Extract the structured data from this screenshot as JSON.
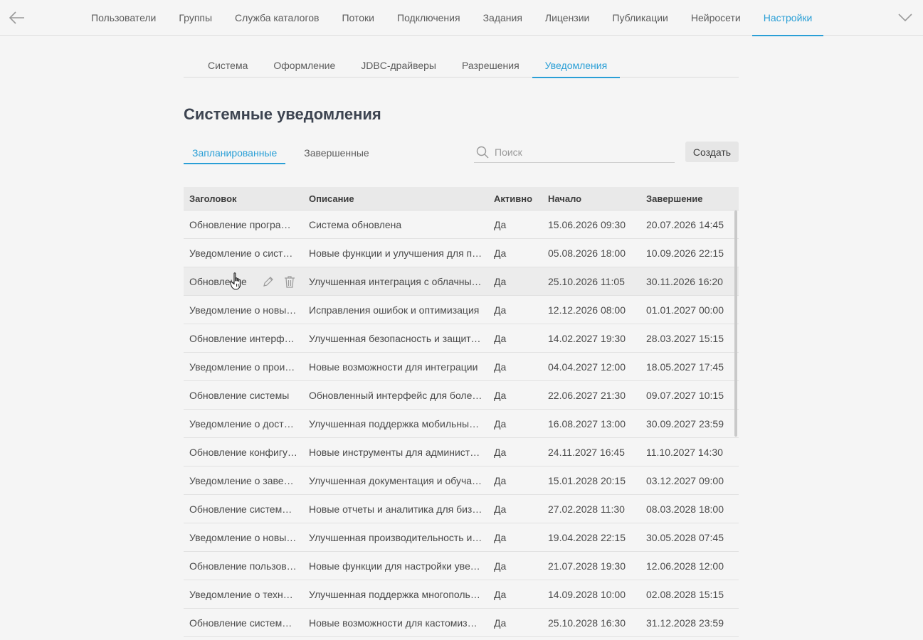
{
  "nav": {
    "items": [
      {
        "label": "Пользователи",
        "active": false
      },
      {
        "label": "Группы",
        "active": false
      },
      {
        "label": "Служба каталогов",
        "active": false
      },
      {
        "label": "Потоки",
        "active": false
      },
      {
        "label": "Подключения",
        "active": false
      },
      {
        "label": "Задания",
        "active": false
      },
      {
        "label": "Лицензии",
        "active": false
      },
      {
        "label": "Публикации",
        "active": false
      },
      {
        "label": "Нейросети",
        "active": false
      },
      {
        "label": "Настройки",
        "active": true
      }
    ]
  },
  "settings_tabs": [
    {
      "label": "Система",
      "active": false
    },
    {
      "label": "Оформление",
      "active": false
    },
    {
      "label": "JDBC-драйверы",
      "active": false
    },
    {
      "label": "Разрешения",
      "active": false
    },
    {
      "label": "Уведомления",
      "active": true
    }
  ],
  "page": {
    "title": "Системные уведомления"
  },
  "filter_tabs": [
    {
      "label": "Запланированные",
      "active": true
    },
    {
      "label": "Завершенные",
      "active": false
    }
  ],
  "search": {
    "placeholder": "Поиск",
    "value": ""
  },
  "create_label": "Создать",
  "table": {
    "columns": [
      "Заголовок",
      "Описание",
      "Активно",
      "Начало",
      "Завершение"
    ],
    "rows": [
      {
        "title": "Обновление программного обеспечения",
        "desc": "Система обновлена",
        "active": "Да",
        "start": "15.06.2026 09:30",
        "end": "20.07.2026 14:45"
      },
      {
        "title": "Уведомление о системе",
        "desc": "Новые функции и улучшения для пользователей",
        "active": "Да",
        "start": "05.08.2026 18:00",
        "end": "10.09.2026 22:15"
      },
      {
        "title": "Обновление",
        "desc": "Улучшенная интеграция с облачными сервисами",
        "active": "Да",
        "start": "25.10.2026 11:05",
        "end": "30.11.2026 16:20",
        "hover": true
      },
      {
        "title": "Уведомление о новых функциях",
        "desc": "Исправления ошибок и оптимизация",
        "active": "Да",
        "start": "12.12.2026 08:00",
        "end": "01.01.2027 00:00"
      },
      {
        "title": "Обновление интерфейса",
        "desc": "Улучшенная безопасность и защита данных",
        "active": "Да",
        "start": "14.02.2027 19:30",
        "end": "28.03.2027 15:15"
      },
      {
        "title": "Уведомление о производительности",
        "desc": "Новые возможности для интеграции",
        "active": "Да",
        "start": "04.04.2027 12:00",
        "end": "18.05.2027 17:45"
      },
      {
        "title": "Обновление системы",
        "desc": "Обновленный интерфейс для более удобной работы",
        "active": "Да",
        "start": "22.06.2027 21:30",
        "end": "09.07.2027 10:15"
      },
      {
        "title": "Уведомление о доступности",
        "desc": "Улучшенная поддержка мобильных устройств",
        "active": "Да",
        "start": "16.08.2027 13:00",
        "end": "30.09.2027 23:59"
      },
      {
        "title": "Обновление конфигурации",
        "desc": "Новые инструменты для администраторов",
        "active": "Да",
        "start": "24.11.2027 16:45",
        "end": "11.10.2027 14:30"
      },
      {
        "title": "Уведомление о завершении",
        "desc": "Улучшенная документация и обучающие материалы",
        "active": "Да",
        "start": "15.01.2028 20:15",
        "end": "03.12.2027 09:00"
      },
      {
        "title": "Обновление системы безопасности",
        "desc": "Новые отчеты и аналитика для бизнеса",
        "active": "Да",
        "start": "27.02.2028 11:30",
        "end": "08.03.2028 18:00"
      },
      {
        "title": "Уведомление о новых возможностях",
        "desc": "Улучшенная производительность и стабильность",
        "active": "Да",
        "start": "19.04.2028 22:15",
        "end": "30.05.2028 07:45"
      },
      {
        "title": "Обновление пользовательских настроек",
        "desc": "Новые функции для настройки уведомлений",
        "active": "Да",
        "start": "21.07.2028 19:30",
        "end": "12.06.2028 12:00"
      },
      {
        "title": "Уведомление о техническом обслуживании",
        "desc": "Улучшенная поддержка многопользовательского режима",
        "active": "Да",
        "start": "14.09.2028 10:00",
        "end": "02.08.2028 15:15"
      },
      {
        "title": "Обновление системы отчетов",
        "desc": "Новые возможности для кастомизации",
        "active": "Да",
        "start": "25.10.2028 16:30",
        "end": "31.12.2028 23:59"
      }
    ]
  }
}
